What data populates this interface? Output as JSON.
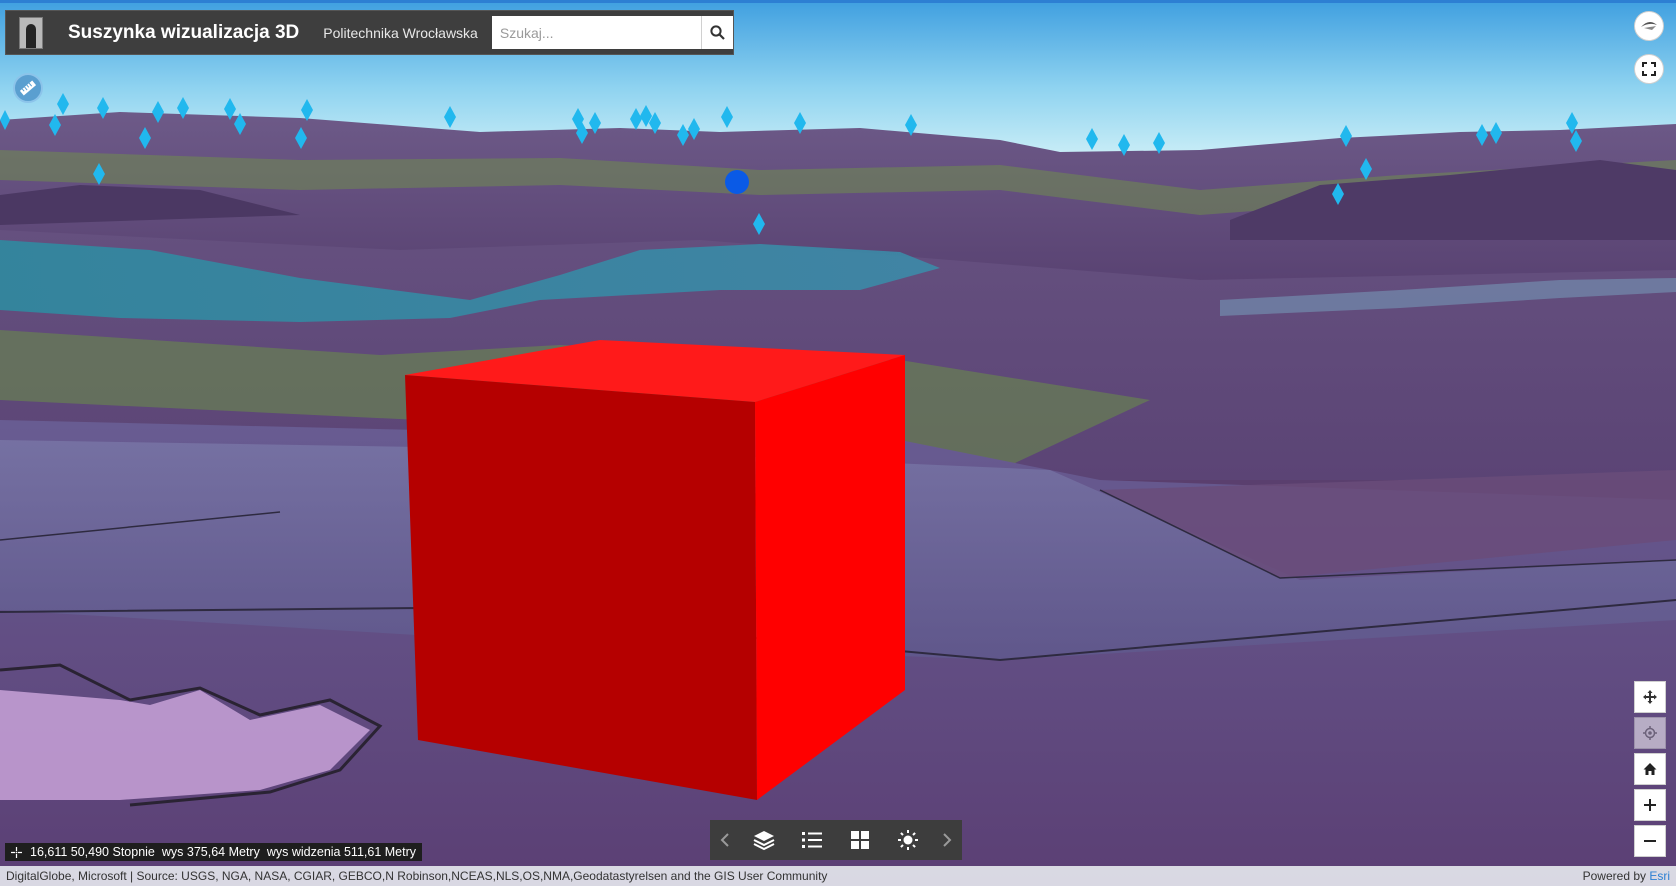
{
  "header": {
    "title": "Suszynka wizualizacja 3D",
    "subtitle": "Politechnika Wrocławska",
    "search_placeholder": "Szukaj...",
    "logo_icon": "building-logo-icon",
    "search_icon": "search-icon"
  },
  "widgets": {
    "measure_icon": "ruler-icon",
    "tilt_icon": "compass-eye-icon",
    "fullscreen_icon": "fullscreen-icon"
  },
  "navigation": {
    "buttons": [
      {
        "name": "pan-button",
        "icon": "move-icon",
        "enabled": true
      },
      {
        "name": "locate-button",
        "icon": "locate-icon",
        "enabled": false
      },
      {
        "name": "home-button",
        "icon": "home-icon",
        "enabled": true
      },
      {
        "name": "zoom-in-button",
        "icon": "plus-icon",
        "enabled": true
      },
      {
        "name": "zoom-out-button",
        "icon": "minus-icon",
        "enabled": true
      }
    ]
  },
  "toolbar": {
    "items": [
      "chevron-left-icon",
      "layers-icon",
      "legend-list-icon",
      "basemap-grid-icon",
      "daylight-sun-icon",
      "chevron-right-icon"
    ]
  },
  "coordinates": {
    "position": "16,611 50,490 Stopnie",
    "elevation": "wys 375,64 Metry",
    "view_height": "wys widzenia 511,61 Metry"
  },
  "attribution": {
    "text": "DigitalGlobe, Microsoft | Source: USGS, NGA, NASA, CGIAR, GEBCO,N Robinson,NCEAS,NLS,OS,NMA,Geodatastyrelsen and the GIS User Community",
    "powered_by": "Powered by ",
    "esri": "Esri"
  },
  "colors": {
    "sky_top": "#4aa7e4",
    "sky_bottom": "#bfeaf6",
    "terrain_purple": "#5e4277",
    "cube_red": "#ff0000",
    "marker_cyan": "#21b8ee",
    "selected_point_blue": "#0a5ae6",
    "header_bg": "#3e3e3e"
  }
}
